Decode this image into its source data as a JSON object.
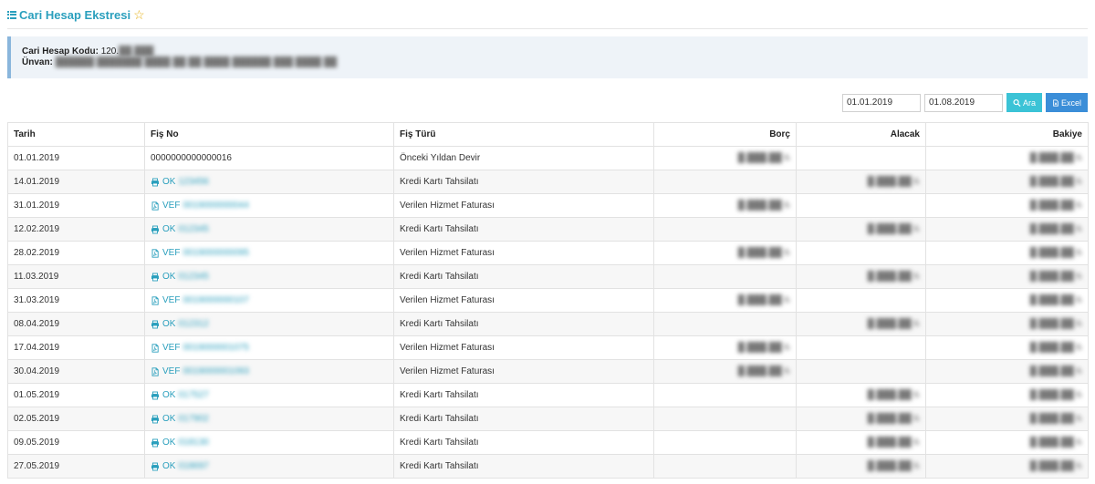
{
  "header": {
    "title": "Cari Hesap Ekstresi",
    "menu_icon": "list-icon",
    "favorite_icon": "star-outline-icon"
  },
  "info": {
    "code_label": "Cari Hesap Kodu:",
    "code_value": "120.",
    "unvan_label": "Ünvan:"
  },
  "controls": {
    "start_date": "01.01.2019",
    "end_date": "01.08.2019",
    "search_label": "Ara",
    "excel_label": "Excel"
  },
  "table": {
    "headers": [
      "Tarih",
      "Fiş No",
      "Fiş Türü",
      "Borç",
      "Alacak",
      "Bakiye"
    ],
    "rows": [
      {
        "tarih": "01.01.2019",
        "fis_prefix": "0000000000000016",
        "icon": "",
        "tur": "Önceki Yıldan Devir"
      },
      {
        "tarih": "14.01.2019",
        "fis_prefix": "OK",
        "icon": "printer",
        "tur": "Kredi Kartı Tahsilatı"
      },
      {
        "tarih": "31.01.2019",
        "fis_prefix": "VEF",
        "icon": "pdf",
        "tur": "Verilen Hizmet Faturası"
      },
      {
        "tarih": "12.02.2019",
        "fis_prefix": "OK",
        "icon": "printer",
        "tur": "Kredi Kartı Tahsilatı"
      },
      {
        "tarih": "28.02.2019",
        "fis_prefix": "VEF",
        "icon": "pdf",
        "tur": "Verilen Hizmet Faturası"
      },
      {
        "tarih": "11.03.2019",
        "fis_prefix": "OK",
        "icon": "printer",
        "tur": "Kredi Kartı Tahsilatı"
      },
      {
        "tarih": "31.03.2019",
        "fis_prefix": "VEF",
        "icon": "pdf",
        "tur": "Verilen Hizmet Faturası"
      },
      {
        "tarih": "08.04.2019",
        "fis_prefix": "OK",
        "icon": "printer",
        "tur": "Kredi Kartı Tahsilatı"
      },
      {
        "tarih": "17.04.2019",
        "fis_prefix": "VEF",
        "icon": "pdf",
        "tur": "Verilen Hizmet Faturası"
      },
      {
        "tarih": "30.04.2019",
        "fis_prefix": "VEF",
        "icon": "pdf",
        "tur": "Verilen Hizmet Faturası"
      },
      {
        "tarih": "01.05.2019",
        "fis_prefix": "OK",
        "icon": "printer",
        "tur": "Kredi Kartı Tahsilatı"
      },
      {
        "tarih": "02.05.2019",
        "fis_prefix": "OK",
        "icon": "printer",
        "tur": "Kredi Kartı Tahsilatı"
      },
      {
        "tarih": "09.05.2019",
        "fis_prefix": "OK",
        "icon": "printer",
        "tur": "Kredi Kartı Tahsilatı"
      },
      {
        "tarih": "27.05.2019",
        "fis_prefix": "OK",
        "icon": "printer",
        "tur": "Kredi Kartı Tahsilatı"
      }
    ]
  },
  "colors": {
    "accent": "#2a9fbd",
    "star": "#e5b31c",
    "search_button": "#3bc3d6",
    "excel_button": "#3b8ed8"
  }
}
